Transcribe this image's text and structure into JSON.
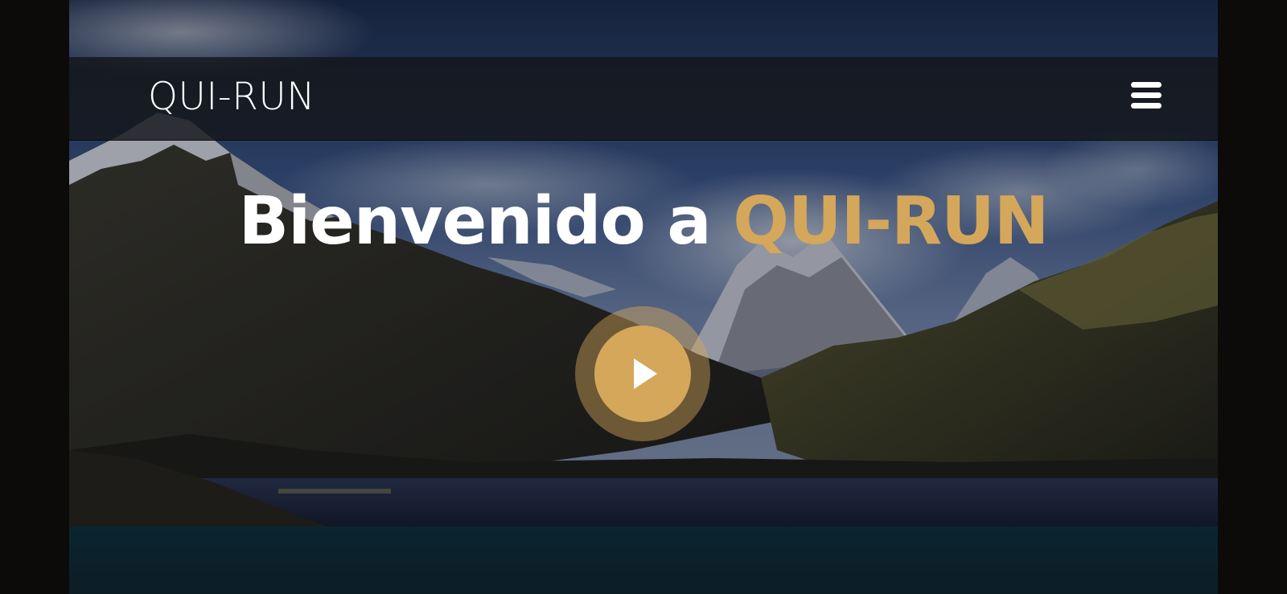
{
  "header": {
    "brand": "QUI-RUN",
    "menu_icon": "hamburger-menu-icon"
  },
  "hero": {
    "title_prefix": "Bienvenido a ",
    "title_accent": "QUI-RUN",
    "play_icon": "play-icon",
    "background": "mountain-lake-landscape"
  },
  "colors": {
    "accent": "#d4a75a",
    "text": "#ffffff",
    "navbar": "#14161a",
    "below_section": "#0b1c24"
  }
}
